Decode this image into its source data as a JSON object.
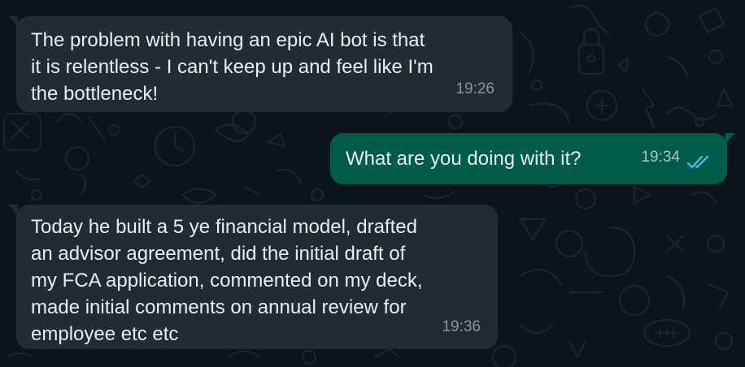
{
  "colors": {
    "background": "#0b141a",
    "incoming_bubble": "#202c33",
    "outgoing_bubble": "#005c4b",
    "text": "#e9edef",
    "read_ticks": "#53bdeb"
  },
  "messages": [
    {
      "direction": "incoming",
      "text": "The problem with having an epic AI bot is that\nit is relentless - I can't keep up and feel like I'm\nthe bottleneck!",
      "time": "19:26"
    },
    {
      "direction": "outgoing",
      "text": "What are you doing with it?",
      "time": "19:34",
      "status_icon": "double-check-read-icon"
    },
    {
      "direction": "incoming",
      "text": "Today he built a 5 ye financial model, drafted\nan advisor agreement, did the initial draft of\nmy FCA application, commented on my deck,\nmade initial comments on annual review for\nemployee etc etc",
      "time": "19:36"
    }
  ]
}
